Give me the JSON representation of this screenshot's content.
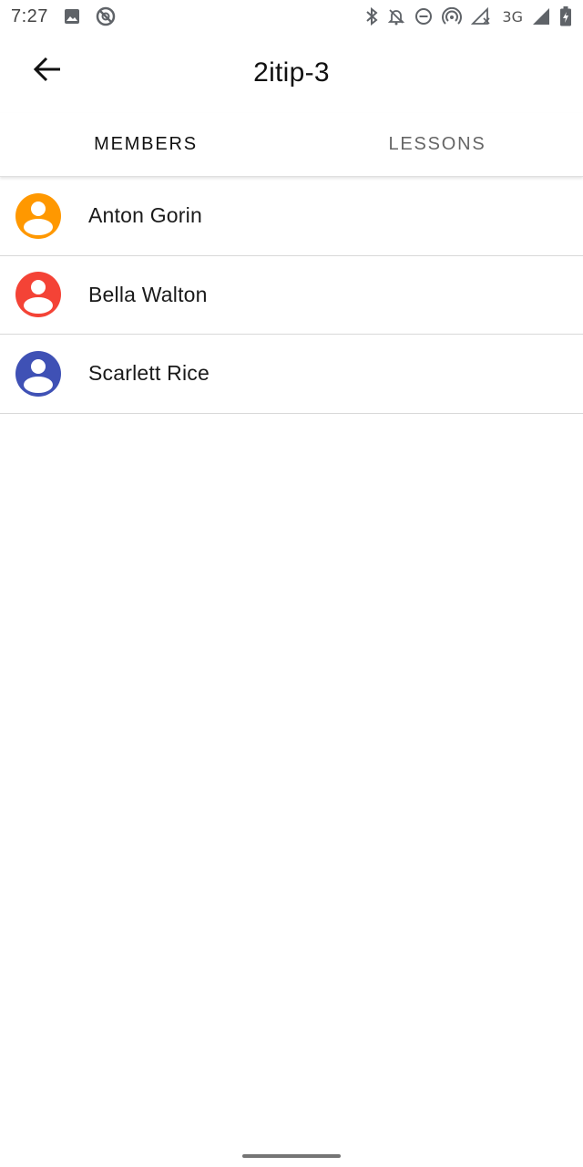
{
  "status_bar": {
    "time": "7:27",
    "network_label": "3G",
    "icons_left": [
      "image-icon",
      "location-off-icon"
    ],
    "icons_right": [
      "bluetooth-icon",
      "notifications-off-icon",
      "dnd-icon",
      "hotspot-icon",
      "signal-no-data-icon",
      "signal-icon",
      "battery-charging-icon"
    ]
  },
  "app_bar": {
    "back_icon": "arrow-back-icon",
    "title": "2itip-3"
  },
  "tabs": [
    {
      "label": "MEMBERS",
      "active": true
    },
    {
      "label": "LESSONS",
      "active": false
    }
  ],
  "members": [
    {
      "name": "Anton Gorin",
      "color": "#FF9800"
    },
    {
      "name": "Bella Walton",
      "color": "#F44336"
    },
    {
      "name": "Scarlett Rice",
      "color": "#3F51B5"
    }
  ]
}
